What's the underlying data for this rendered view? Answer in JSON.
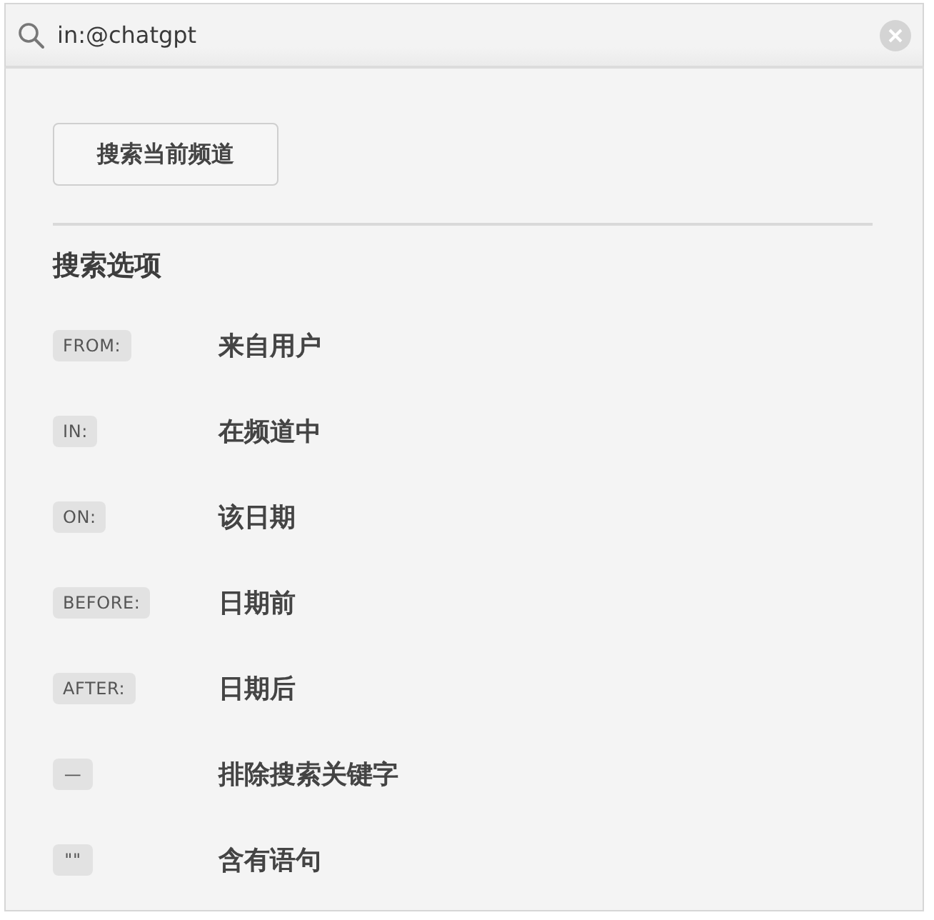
{
  "search": {
    "value": "in:@chatgpt"
  },
  "button": "搜索当前频道",
  "section_title": "搜索选项",
  "options": [
    {
      "tag": "FROM:",
      "label": "来自用户"
    },
    {
      "tag": "IN:",
      "label": "在频道中"
    },
    {
      "tag": "ON:",
      "label": "该日期"
    },
    {
      "tag": "BEFORE:",
      "label": "日期前"
    },
    {
      "tag": "AFTER:",
      "label": "日期后"
    },
    {
      "tag": "—",
      "label": "排除搜索关键字"
    },
    {
      "tag": "\"\"",
      "label": "含有语句"
    }
  ]
}
